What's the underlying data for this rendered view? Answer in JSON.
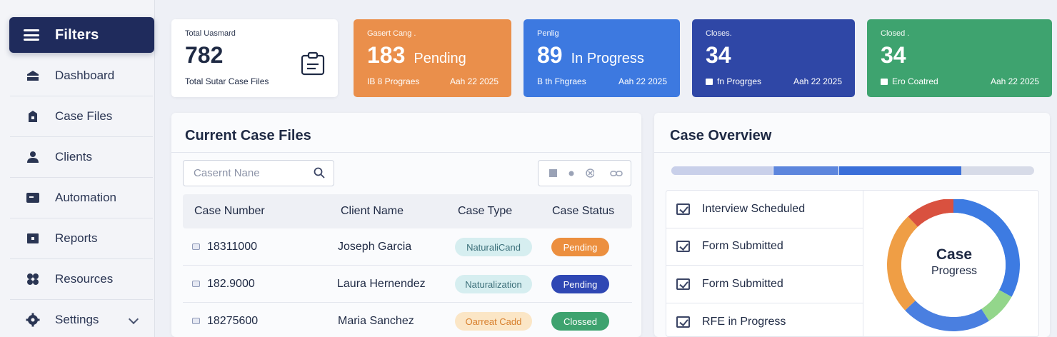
{
  "sidebar": {
    "filters_label": "Filters",
    "items": [
      {
        "label": "Dashboard",
        "icon": "dashboard-icon"
      },
      {
        "label": "Case Files",
        "icon": "case-files-icon"
      },
      {
        "label": "Clients",
        "icon": "clients-icon"
      },
      {
        "label": "Automation",
        "icon": "automation-icon"
      },
      {
        "label": "Reports",
        "icon": "reports-icon"
      },
      {
        "label": "Resources",
        "icon": "resources-icon"
      },
      {
        "label": "Settings",
        "icon": "settings-icon"
      }
    ]
  },
  "stats": [
    {
      "label": "Total Uasmard",
      "value": "782",
      "foot": "Total Sutar Case Files",
      "color": "#ffffff"
    },
    {
      "label": "Gasert Cang .",
      "value": "183",
      "suffix": "Pending",
      "foot_left": "IB 8 Prograes",
      "foot_right": "Aah 22 2025",
      "color": "#ea8f4b"
    },
    {
      "label": "Penlig",
      "value": "89",
      "suffix": "In Progress",
      "foot_left": "B th Fhgraes",
      "foot_right": "Aah 22 2025",
      "color": "#3d79e0"
    },
    {
      "label": "Closes.",
      "value": "34",
      "foot_left": "fn Progrges",
      "foot_right": "Aah 22 2025",
      "color": "#2f47a6"
    },
    {
      "label": "Closed .",
      "value": "34",
      "foot_left": "Ero Coatred",
      "foot_right": "Aah 22 2025",
      "color": "#3ea36f"
    }
  ],
  "case_files": {
    "title": "Current Case Files",
    "search_placeholder": "Casernt Nane",
    "columns": [
      "Case Number",
      "Client Name",
      "Case Type",
      "Case Status"
    ],
    "rows": [
      {
        "number": "18311000",
        "client": "Joseph Garcia",
        "type": "NaturaliCand",
        "status": "Pending",
        "status_color": "#ec8f3f"
      },
      {
        "number": "182.9000",
        "client": "Laura Hernendez",
        "type": "Naturalization",
        "status": "Pending",
        "status_color": "#2f47b4"
      },
      {
        "number": "18275600",
        "client": "Maria Sanchez",
        "type": "Oarreat Cadd",
        "status": "Clossed",
        "status_color": "#3ea36f"
      }
    ]
  },
  "overview": {
    "title": "Case Overview",
    "progress_segments": [
      {
        "fraction": 0.28,
        "color": "#c9d0ea"
      },
      {
        "fraction": 0.18,
        "color": "#5d86dd"
      },
      {
        "fraction": 0.34,
        "color": "#3a6fd9"
      }
    ],
    "checklist": [
      "Interview Scheduled",
      "Form Submitted",
      "Form Submitted",
      "RFE in Progress"
    ],
    "donut": {
      "center_title": "Case",
      "center_subtitle": "Progress",
      "slices": [
        {
          "fraction": 0.33,
          "color": "#3d7be2"
        },
        {
          "fraction": 0.08,
          "color": "#93d68b"
        },
        {
          "fraction": 0.22,
          "color": "#4a7fe0"
        },
        {
          "fraction": 0.25,
          "color": "#ef9e45"
        },
        {
          "fraction": 0.12,
          "color": "#d9513f"
        }
      ]
    }
  }
}
